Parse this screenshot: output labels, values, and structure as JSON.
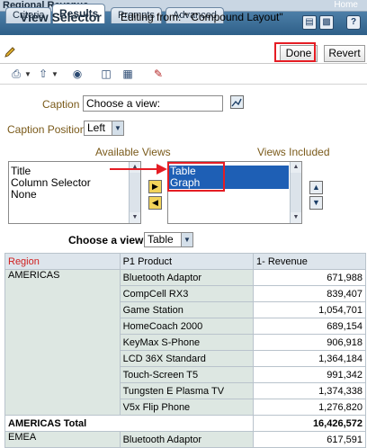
{
  "app": {
    "title": "Regional Revenue",
    "home": "Home"
  },
  "tabs": [
    {
      "label": "Criteria"
    },
    {
      "label": "Results"
    },
    {
      "label": "Prompts"
    },
    {
      "label": "Advanced"
    }
  ],
  "tab_icons": [
    "save-icon",
    "save-as-icon",
    "help-icon"
  ],
  "view_selector": {
    "title": "View Selector",
    "editing_from": "Editing from: \" Compound Layout\"",
    "done_label": "Done",
    "revert_label": "Revert"
  },
  "toolbar": {
    "icons": [
      "print-icon",
      "export-icon",
      "find-icon",
      "view-icon",
      "layout-icon",
      "edit-icon"
    ]
  },
  "form": {
    "caption_label": "Caption",
    "caption_value": "Choose a view:",
    "caption_position_label": "Caption Position",
    "caption_position_value": "Left",
    "available_views_label": "Available Views",
    "views_included_label": "Views Included",
    "available_views": [
      "Title",
      "Column Selector",
      "None"
    ],
    "views_included": [
      "Table",
      "Graph"
    ],
    "choose_view_label": "Choose a view:",
    "choose_view_value": "Table"
  },
  "table": {
    "headers": [
      "Region",
      "P1 Product",
      "1- Revenue"
    ],
    "region": "AMERICAS",
    "rows": [
      {
        "product": "Bluetooth Adaptor",
        "revenue": "671,988"
      },
      {
        "product": "CompCell RX3",
        "revenue": "839,407"
      },
      {
        "product": "Game Station",
        "revenue": "1,054,701"
      },
      {
        "product": "HomeCoach 2000",
        "revenue": "689,154"
      },
      {
        "product": "KeyMax S-Phone",
        "revenue": "906,918"
      },
      {
        "product": "LCD 36X Standard",
        "revenue": "1,364,184"
      },
      {
        "product": "Touch-Screen T5",
        "revenue": "991,342"
      },
      {
        "product": "Tungsten E Plasma TV",
        "revenue": "1,374,338"
      },
      {
        "product": "V5x Flip Phone",
        "revenue": "1,276,820"
      }
    ],
    "total_label": "AMERICAS Total",
    "total_value": "16,426,572",
    "next_region": "EMEA",
    "next_product": "Bluetooth Adaptor",
    "next_revenue": "617,591"
  },
  "colors": {
    "accent": "#2e5f88",
    "annotation": "#e51d24",
    "selection": "#1e5fb5"
  }
}
